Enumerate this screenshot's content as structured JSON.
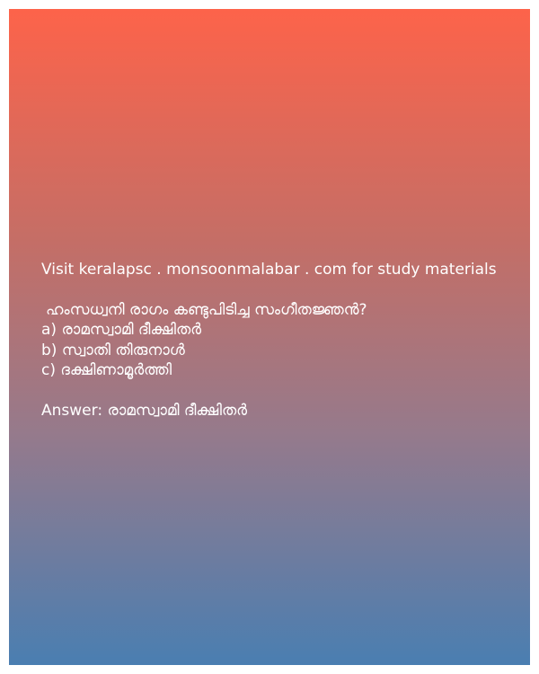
{
  "promo_text": "Visit keralapsc . monsoonmalabar . com for study materials",
  "question": "ഹംസധ്വനി രാഗം കണ്ടുപിടിച്ച സംഗീതജ്ഞൻ?",
  "options": [
    "a) രാമസ്വാമി ദീക്ഷിതർ",
    "b) സ്വാതി തിരുനാൾ",
    "c) ദക്ഷിണാമൂർത്തി"
  ],
  "answer_line": "Answer: രാമസ്വാമി ദീക്ഷിതർ",
  "colors": {
    "gradient_top": "#fd634a",
    "gradient_bottom": "#4a7eb1",
    "text": "#ffffff"
  }
}
